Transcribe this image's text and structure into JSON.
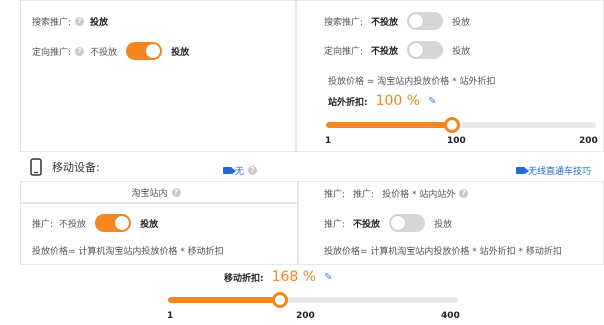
{
  "search_promo": {
    "left": {
      "label": "搜索推广:",
      "value": "投放"
    },
    "right": {
      "label": "搜索推广:",
      "off_label": "不投放",
      "on_label": "投放",
      "enabled": false
    }
  },
  "targeted_promo": {
    "left": {
      "label": "定向推广:",
      "off_label": "不投放",
      "on_label": "投放",
      "enabled": true
    },
    "right": {
      "label": "定向推广:",
      "off_label": "不投放",
      "on_label": "投放",
      "enabled": false
    }
  },
  "pc_offsite": {
    "formula": "投放价格 = 淘宝站内投放价格 * 站外折扣",
    "discount_label": "站外折扣:",
    "discount_value": "100 %",
    "slider": {
      "min": 1,
      "max": 200,
      "value": 100,
      "ticks": [
        "1",
        "100",
        "200"
      ]
    }
  },
  "mobile": {
    "title": "移动设备:",
    "left_tag": "无",
    "right_tag": "无线直通车技巧",
    "left_tab": "淘宝站内",
    "right_tab": {
      "label1": "推广:",
      "label2": "推广:",
      "value": "投价格 * 站内站外"
    },
    "left_promo": {
      "label": "推广:",
      "off_label": "不投放",
      "on_label": "投放",
      "enabled": true
    },
    "right_promo": {
      "label": "推广:",
      "off_label": "不投放",
      "on_label": "投放",
      "enabled": false
    },
    "left_formula": "投放价格= 计算机淘宝站内投放价格 * 移动折扣",
    "right_formula": "投放价格= 计算机淘宝站内投放价格 * 站外折扣 * 移动折扣",
    "discount_label": "移动折扣:",
    "discount_value": "168 %",
    "slider": {
      "min": 1,
      "max": 400,
      "value": 168,
      "ticks": [
        "1",
        "200",
        "400"
      ]
    }
  },
  "colors": {
    "accent": "#f5871f",
    "link": "#1e6ad6"
  }
}
